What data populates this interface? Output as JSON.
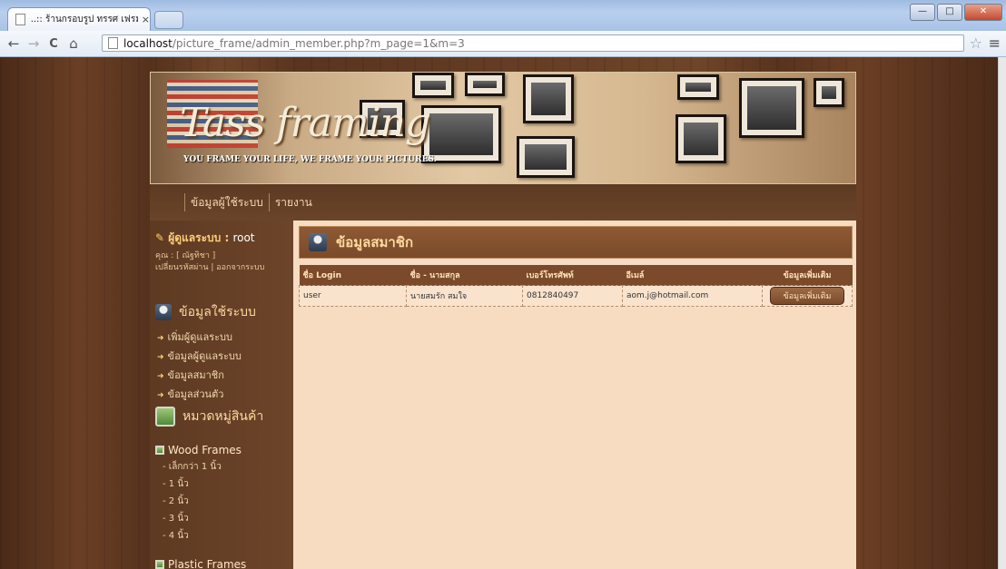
{
  "browser": {
    "tab_title": "..:: ร้านกรอบรูป ทรรศ เฟรมมิ่ง",
    "tab_close": "×",
    "url_host": "localhost",
    "url_path": "/picture_frame/admin_member.php?m_page=1&m=3",
    "win_min": "—",
    "win_max": "□",
    "win_close": "✕",
    "back_icon": "←",
    "forward_icon": "→",
    "reload_icon": "C",
    "home_icon": "⌂",
    "star_icon": "☆",
    "menu_icon": "≡"
  },
  "banner": {
    "logo": "Tass framing",
    "slogan": "YOU FRAME YOUR LIFE, WE FRAME YOUR PICTURES."
  },
  "menu": {
    "items": [
      "ข้อมูลผู้ใช้ระบบ",
      "รายงาน"
    ]
  },
  "sidebar": {
    "admin_label": "ผู้ดูแลระบบ : ",
    "admin_value": "root",
    "user_line": "คุณ : [ ณัฐทิชา ]",
    "account_links": "เปลี่ยนรหัสผ่าน | ออกจากระบบ",
    "section_system": "ข้อมูลใช้ระบบ",
    "system_items": [
      "เพิ่มผู้ดูแลระบบ",
      "ข้อมูลผู้ดูแลระบบ",
      "ข้อมูลสมาชิก",
      "ข้อมูลส่วนตัว"
    ],
    "section_category": "หมวดหมู่สินค้า",
    "category_wood": "Wood Frames",
    "wood_items": [
      "- เล็กกว่า 1 นิ้ว",
      "- 1 นิ้ว",
      "- 2 นิ้ว",
      "- 3 นิ้ว",
      "- 4 นิ้ว"
    ],
    "category_plastic": "Plastic Frames"
  },
  "content": {
    "title": "ข้อมูลสมาชิก",
    "columns": [
      "ชื่อ Login",
      "ชื่อ - นามสกุล",
      "เบอร์โทรศัพท์",
      "อีเมล์",
      "ข้อมูลเพิ่มเติม"
    ],
    "rows": [
      {
        "login": "user",
        "name": "นายสมรัก สมใจ",
        "phone": "0812840497",
        "email": "aom.j@hotmail.com",
        "action": "ข้อมูลเพิ่มเติม"
      }
    ]
  }
}
